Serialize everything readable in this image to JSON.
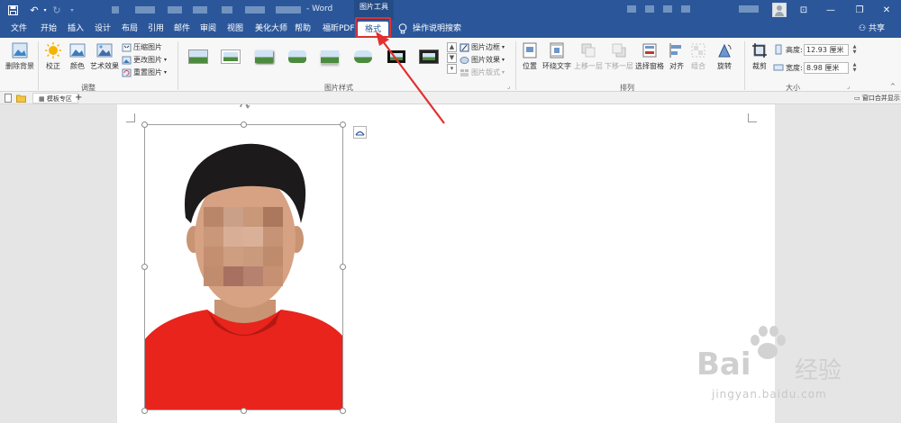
{
  "titlebar": {
    "doc_title": "- Word",
    "tools_label": "图片工具",
    "min_label": "—",
    "restore_label": "❐",
    "close_label": "✕",
    "ribbon_toggle_label": "⊡"
  },
  "tabs": [
    {
      "label": "文件"
    },
    {
      "label": "开始"
    },
    {
      "label": "插入"
    },
    {
      "label": "设计"
    },
    {
      "label": "布局"
    },
    {
      "label": "引用"
    },
    {
      "label": "邮件"
    },
    {
      "label": "审阅"
    },
    {
      "label": "视图"
    },
    {
      "label": "美化大师"
    },
    {
      "label": "帮助"
    },
    {
      "label": "福昕PDF"
    },
    {
      "label": "格式"
    }
  ],
  "search_tab": {
    "label": "操作说明搜索"
  },
  "share": {
    "label": "共享"
  },
  "ribbon": {
    "remove_bg": "删除背景",
    "correct": "校正",
    "color": "颜色",
    "art_effects": "艺术效果",
    "compress": "压缩图片",
    "change": "更改图片",
    "reset": "重置图片",
    "group_adjust": "调整",
    "border": "图片边框",
    "effects": "图片效果",
    "layout": "图片版式",
    "group_styles": "图片样式",
    "position": "位置",
    "wrap": "环绕文字",
    "forward": "上移一层",
    "backward": "下移一层",
    "selection": "选择窗格",
    "align": "对齐",
    "group": "组合",
    "rotate": "旋转",
    "group_arrange": "排列",
    "crop": "裁剪",
    "height_label": "高度:",
    "height_value": "12.93 厘米",
    "width_label": "宽度:",
    "width_value": "8.98 厘米",
    "group_size": "大小"
  },
  "doctabs": {
    "template_label": "模板专区",
    "add_label": "+",
    "merge_label": "窗口合并显示"
  },
  "watermark": {
    "brand": "Bai",
    "brand_cn": "经验",
    "url": "jingyan.baidu.com"
  },
  "colors": {
    "accent": "#2b579a",
    "highlight_red": "#e23030",
    "shirt_red": "#e8241c"
  }
}
